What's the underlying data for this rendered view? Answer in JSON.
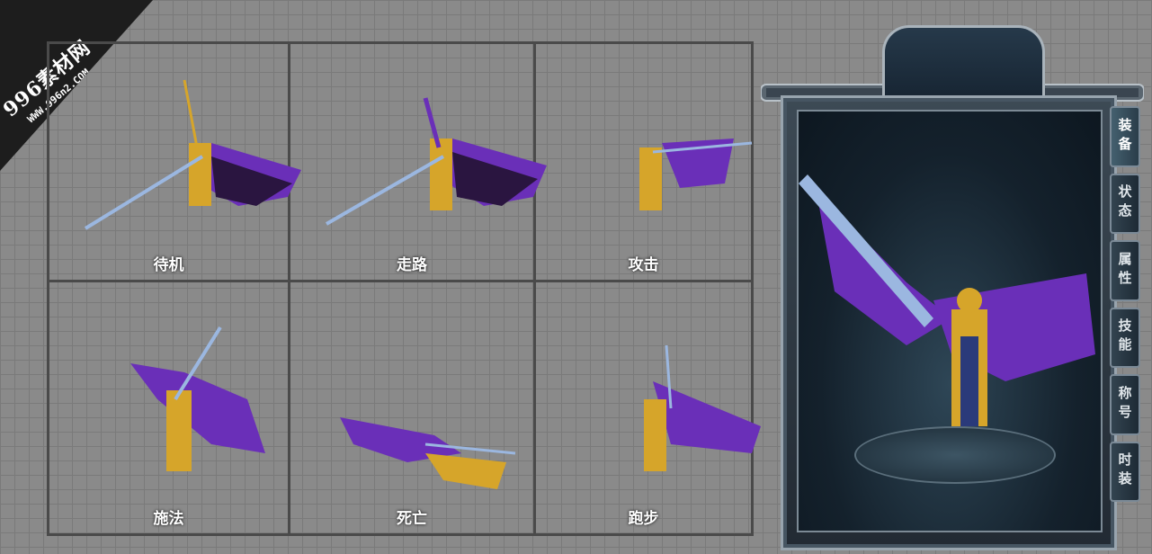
{
  "watermark": {
    "main": "996素材网",
    "sub": "WWW.996n2.COM"
  },
  "actions": [
    {
      "label": "待机"
    },
    {
      "label": "走路"
    },
    {
      "label": "攻击"
    },
    {
      "label": "施法"
    },
    {
      "label": "死亡"
    },
    {
      "label": "跑步"
    }
  ],
  "panel": {
    "tabs": [
      "装备",
      "状态",
      "属性",
      "技能",
      "称号",
      "时装"
    ]
  },
  "colors": {
    "wing": "#6a2fb8",
    "gold": "#d6a52a",
    "blade": "#9bb7e0"
  }
}
